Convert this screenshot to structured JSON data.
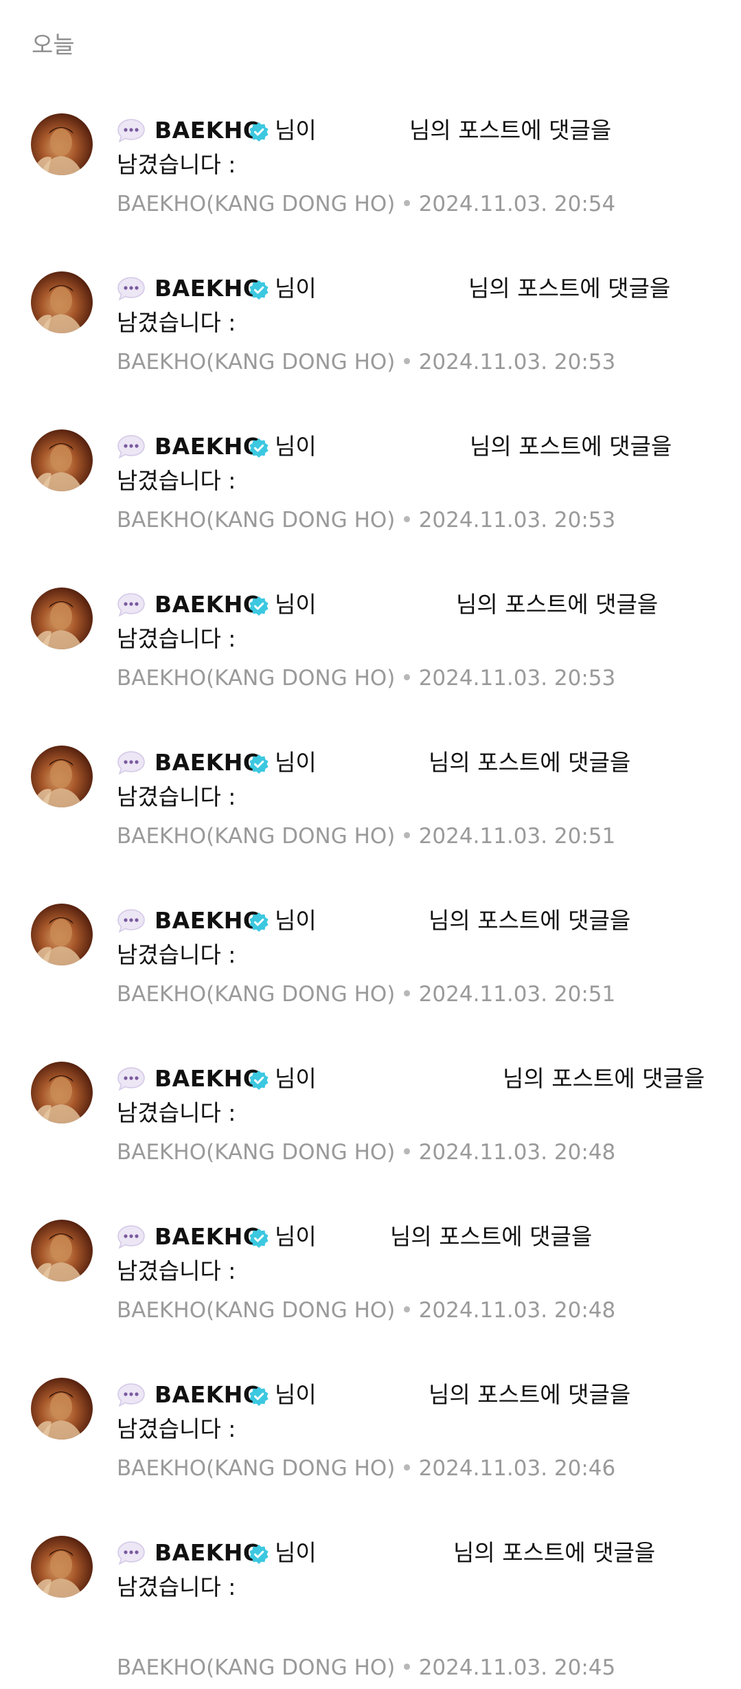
{
  "section_header": "오늘",
  "notifications": [
    {
      "username": "BAEKHO",
      "action_prefix": "님이",
      "action_suffix": "님의 포스트에 댓글을",
      "action_line2": "남겼습니다 :",
      "source": "BAEKHO(KANG DONG HO)",
      "timestamp": "2024.11.03. 20:54"
    },
    {
      "username": "BAEKHO",
      "action_prefix": "님이",
      "action_suffix": "님의 포스트에 댓글을",
      "action_line2": "남겼습니다 :",
      "source": "BAEKHO(KANG DONG HO)",
      "timestamp": "2024.11.03. 20:53"
    },
    {
      "username": "BAEKHO",
      "action_prefix": "님이",
      "action_suffix": "님의 포스트에 댓글을",
      "action_line2": "남겼습니다 :",
      "source": "BAEKHO(KANG DONG HO)",
      "timestamp": "2024.11.03. 20:53"
    },
    {
      "username": "BAEKHO",
      "action_prefix": "님이",
      "action_suffix": "님의 포스트에 댓글을",
      "action_line2": "남겼습니다 :",
      "source": "BAEKHO(KANG DONG HO)",
      "timestamp": "2024.11.03. 20:53"
    },
    {
      "username": "BAEKHO",
      "action_prefix": "님이",
      "action_suffix": "님의 포스트에 댓글을",
      "action_line2": "남겼습니다 :",
      "source": "BAEKHO(KANG DONG HO)",
      "timestamp": "2024.11.03. 20:51"
    },
    {
      "username": "BAEKHO",
      "action_prefix": "님이",
      "action_suffix": "님의 포스트에 댓글을",
      "action_line2": "남겼습니다 :",
      "source": "BAEKHO(KANG DONG HO)",
      "timestamp": "2024.11.03. 20:51"
    },
    {
      "username": "BAEKHO",
      "action_prefix": "님이",
      "action_suffix": "님의 포스트에 댓글을",
      "action_line2": "남겼습니다 :",
      "source": "BAEKHO(KANG DONG HO)",
      "timestamp": "2024.11.03. 20:48"
    },
    {
      "username": "BAEKHO",
      "action_prefix": "님이",
      "action_suffix": "님의 포스트에 댓글을",
      "action_line2": "남겼습니다 :",
      "source": "BAEKHO(KANG DONG HO)",
      "timestamp": "2024.11.03. 20:48"
    },
    {
      "username": "BAEKHO",
      "action_prefix": "님이",
      "action_suffix": "님의 포스트에 댓글을",
      "action_line2": "남겼습니다 :",
      "source": "BAEKHO(KANG DONG HO)",
      "timestamp": "2024.11.03. 20:46"
    },
    {
      "username": "BAEKHO",
      "action_prefix": "님이",
      "action_suffix": "님의 포스트에 댓글을",
      "action_line2": "남겼습니다 :",
      "source": "BAEKHO(KANG DONG HO)",
      "timestamp": "2024.11.03. 20:45"
    }
  ],
  "icons": {
    "bubble": "chat-bubble-icon",
    "verified": "verified-badge-icon"
  },
  "colors": {
    "verified": "#3cc8e0",
    "bubble_fill": "#ece6f5",
    "bubble_dots": "#7a5a9e",
    "meta_text": "#9a9a9a",
    "header_text": "#8e8e8e"
  }
}
